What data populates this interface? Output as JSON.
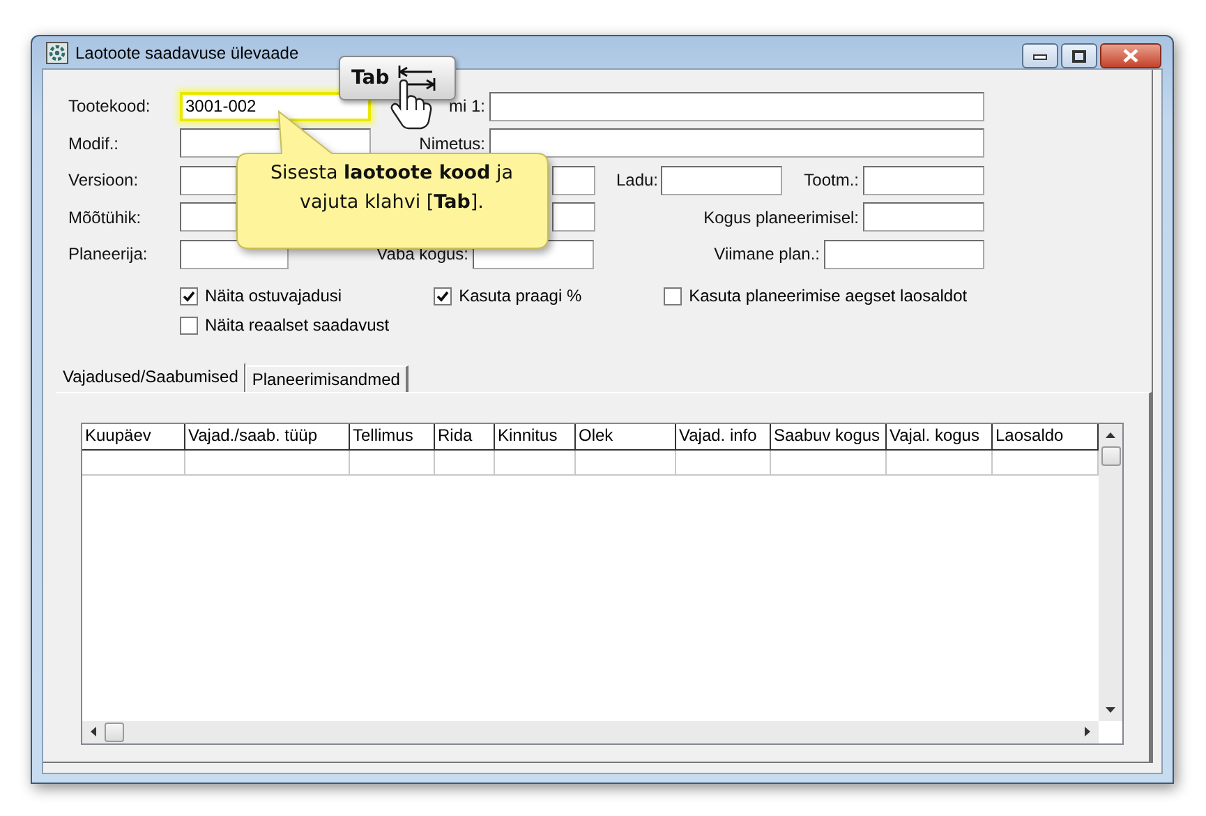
{
  "window": {
    "title": "Laotoote saadavuse ülevaade"
  },
  "form_rows": [
    [
      {
        "kind": "text",
        "label": "Tootekood:",
        "value": "3001-002",
        "focused": true
      },
      {
        "kind": "text",
        "label": "mi 1:"
      }
    ],
    [
      {
        "kind": "text",
        "label": "Modif.:"
      },
      {
        "kind": "text",
        "label": "Nimetus:"
      }
    ],
    [
      {
        "kind": "text",
        "label": "Versioon:"
      },
      {
        "kind": "text"
      },
      {
        "kind": "text",
        "label": "Ladu:"
      },
      {
        "kind": "text",
        "label": "Tootm.:"
      }
    ],
    [
      {
        "kind": "text",
        "label": "Mõõtühik:"
      },
      {
        "kind": "text"
      },
      {
        "kind": "text",
        "label": "Kogus planeerimisel:"
      }
    ],
    [
      {
        "kind": "text",
        "label": "Planeerija:"
      },
      {
        "kind": "text",
        "label": "Vaba kogus:"
      },
      {
        "kind": "text",
        "label": "Viimane plan.:"
      }
    ]
  ],
  "options": [
    [
      {
        "label": "Näita ostuvajadusi",
        "checked": true
      },
      {
        "label": "Kasuta praagi %",
        "checked": true
      },
      {
        "label": "Kasuta planeerimise aegset laosaldot",
        "checked": false
      }
    ],
    [
      {
        "label": "Näita reaalset saadavust",
        "checked": false
      }
    ]
  ],
  "tabs": [
    {
      "label": "Vajadused/Saabumised",
      "selected": true
    },
    {
      "label": "Planeerimisandmed",
      "selected": false
    }
  ],
  "table": {
    "columns": [
      "Kuupäev",
      "Vajad./saab. tüüp",
      "Tellimus",
      "Rida",
      "Kinnitus",
      "Olek",
      "Vajad. info",
      "Saabuv kogus",
      "Vajal. kogus",
      "Laosaldo"
    ]
  },
  "callout": {
    "text": "Sisesta **laotoote kood** ja vajuta klahvi [**Tab**]."
  },
  "key_hint": {
    "label": "Tab"
  }
}
